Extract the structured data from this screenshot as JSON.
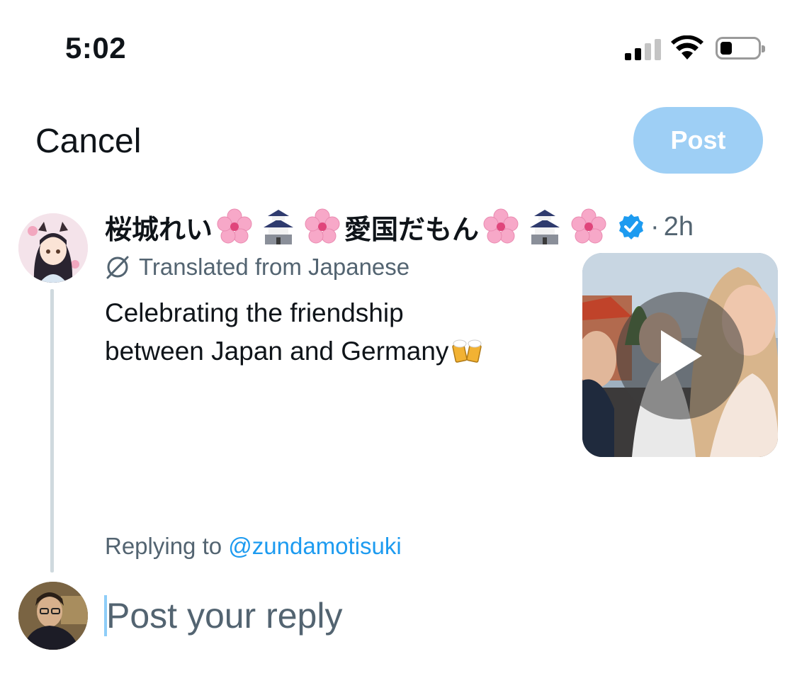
{
  "status_bar": {
    "time": "5:02",
    "signal_icon": "cellular-signal-icon",
    "wifi_icon": "wifi-icon",
    "battery_icon": "battery-icon",
    "battery_level": 0.25
  },
  "header": {
    "cancel_label": "Cancel",
    "post_label": "Post",
    "post_enabled": false,
    "post_color": "#9ecff5"
  },
  "original_post": {
    "author_name_part1": "桜城れい",
    "author_name_part2": "愛国だもん",
    "name_emojis": [
      "cherry-blossom-icon",
      "castle-icon",
      "cherry-blossom-icon"
    ],
    "verified_icon": "verified-badge-icon",
    "separator": "·",
    "age": "2h",
    "translated_label": "Translated from Japanese",
    "text_line1": "Celebrating the friendship",
    "text_line2": "between Japan and Germany",
    "text_emoji": "beer-mugs-icon",
    "media_type": "video",
    "media_icon": "play-icon"
  },
  "replying": {
    "prefix": "Replying to",
    "handle": "@zundamotisuki"
  },
  "composer": {
    "placeholder": "Post your reply"
  },
  "colors": {
    "accent": "#1d9bf0",
    "secondary_text": "#536471",
    "thread_line": "#cfd9de"
  }
}
